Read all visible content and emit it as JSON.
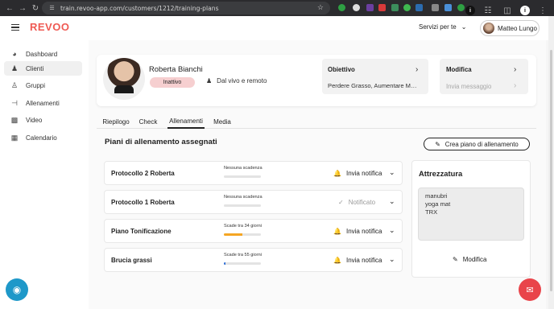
{
  "browser": {
    "url": "train.revoo-app.com/customers/1212/training-plans",
    "profile_initial": "i"
  },
  "app": {
    "logo": "REVOO",
    "services_label": "Servizi per te",
    "user_name": "Matteo Lungo"
  },
  "sidebar": {
    "items": [
      {
        "label": "Dashboard",
        "icon": "gauge-icon"
      },
      {
        "label": "Clienti",
        "icon": "user-icon"
      },
      {
        "label": "Gruppi",
        "icon": "group-icon"
      },
      {
        "label": "Allenamenti",
        "icon": "dumbbell-icon"
      },
      {
        "label": "Video",
        "icon": "film-icon"
      },
      {
        "label": "Calendario",
        "icon": "calendar-icon"
      }
    ]
  },
  "profile": {
    "name": "Roberta Bianchi",
    "status": "Inattivo",
    "mode": "Dal vivo e remoto",
    "objective_title": "Obiettivo",
    "objective_value": "Perdere Grasso, Aumentare Massa Muscolare",
    "edit_label": "Modifica",
    "message_label": "Invia messaggio"
  },
  "tabs": [
    "Riepilogo",
    "Check",
    "Allenamenti",
    "Media"
  ],
  "plans_section": {
    "title": "Piani di allenamento assegnati",
    "create_label": "Crea piano di allenamento"
  },
  "plans": [
    {
      "name": "Protocollo 2 Roberta",
      "expiry": "Nessuna scadenza",
      "action": "Invia notifica",
      "progress": 0,
      "bar_color": "#e3e3e3"
    },
    {
      "name": "Protocollo 1 Roberta",
      "expiry": "Nessuna scadenza",
      "action": "Notificato",
      "progress": 0,
      "bar_color": "#e3e3e3"
    },
    {
      "name": "Piano Tonificazione",
      "expiry": "Scade tra 34 giorni",
      "action": "Invia notifica",
      "progress": 0.5,
      "bar_color": "#f5a623"
    },
    {
      "name": "Brucia grassi",
      "expiry": "Scade tra 55 giorni",
      "action": "Invia notifica",
      "progress": 0.05,
      "bar_color": "#2e6fd8"
    }
  ],
  "equipment": {
    "title": "Attrezzatura",
    "items": [
      "manubri",
      "yoga mat",
      "TRX"
    ],
    "edit_label": "Modifica"
  }
}
